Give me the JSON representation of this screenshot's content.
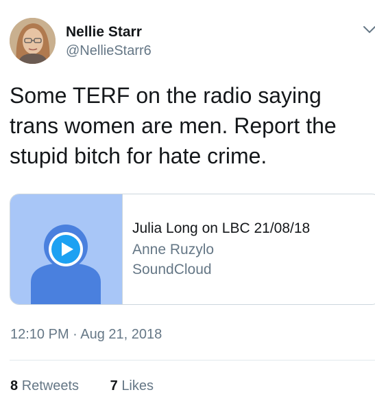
{
  "tweet": {
    "author_name": "Nellie Starr",
    "author_handle": "@NellieStarr6",
    "text": "Some TERF on the radio saying trans women are men. Report the stupid bitch for hate crime.",
    "timestamp": "12:10 PM · Aug 21, 2018",
    "retweet_count": "8",
    "retweet_label": "Retweets",
    "like_count": "7",
    "like_label": "Likes"
  },
  "card": {
    "title": "Julia Long on LBC 21/08/18",
    "author": "Anne Ruzylo",
    "source": "SoundCloud",
    "play_icon": "play-icon"
  },
  "colors": {
    "text_primary": "#14171a",
    "text_secondary": "#657786",
    "card_media_bg": "#a8c6f7",
    "placeholder_blue": "#4a80de",
    "play_button_blue": "#1da1f2",
    "border": "#ccd6dd"
  }
}
